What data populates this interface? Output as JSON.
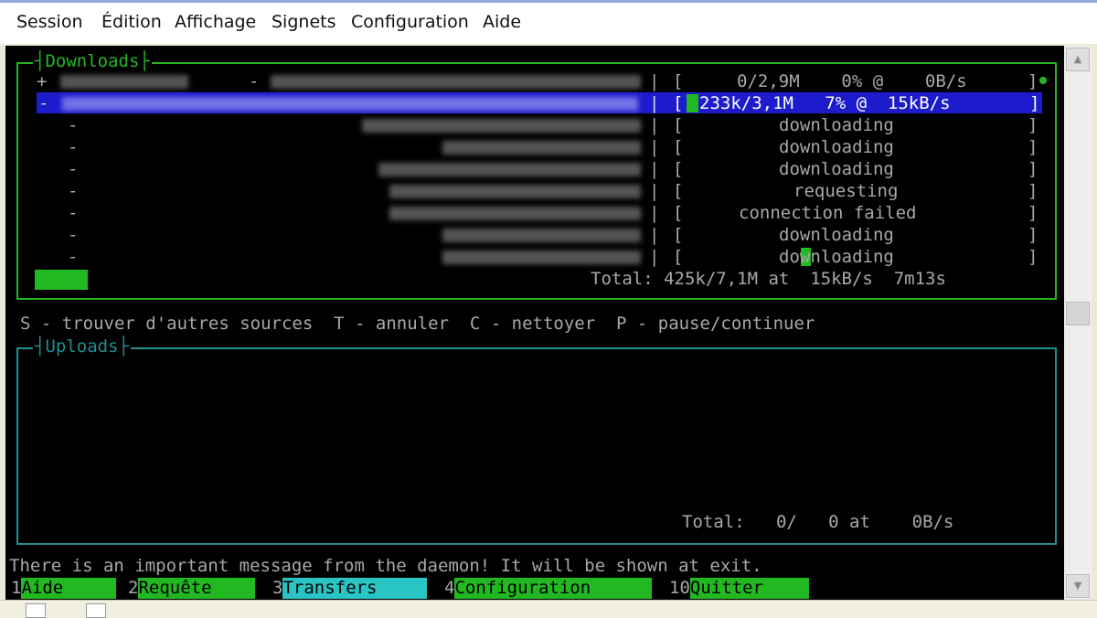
{
  "menubar": [
    "Session",
    "Édition",
    "Affichage",
    "Signets",
    "Configuration",
    "Aide"
  ],
  "downloads": {
    "title": "Downloads",
    "rows": [
      {
        "marker": "+",
        "bracket": "[",
        "status": "0/2,9M    0% @    0B/s",
        "close": "]"
      },
      {
        "marker": "-",
        "bracket": "[",
        "status": "233k/3,1M   7% @  15kB/s",
        "close": "]"
      },
      {
        "marker": "-",
        "bracket": "[",
        "status": "downloading",
        "close": "]"
      },
      {
        "marker": "-",
        "bracket": "[",
        "status": "downloading",
        "close": "]"
      },
      {
        "marker": "-",
        "bracket": "[",
        "status": "downloading",
        "close": "]"
      },
      {
        "marker": "-",
        "bracket": "[",
        "status": "requesting",
        "close": "]"
      },
      {
        "marker": "-",
        "bracket": "[",
        "status": "connection failed",
        "close": "]"
      },
      {
        "marker": "-",
        "bracket": "[",
        "status": "downloading",
        "close": "]"
      },
      {
        "marker": "-",
        "bracket": "[",
        "status": "downloading",
        "close": "]"
      }
    ],
    "total": "Total: 425k/7,1M at  15kB/s  7m13s"
  },
  "commands": "S - trouver d'autres sources  T - annuler  C - nettoyer  P - pause/continuer",
  "uploads": {
    "title": "Uploads",
    "total": "Total:   0/   0 at    0B/s"
  },
  "message": "There is an important message from the daemon! It will be shown at exit.",
  "function_keys": [
    {
      "num": "1",
      "label": "Aide"
    },
    {
      "num": "2",
      "label": "Requête"
    },
    {
      "num": "3",
      "label": "Transfers"
    },
    {
      "num": "4",
      "label": "Configuration"
    },
    {
      "num": "10",
      "label": "Quitter"
    }
  ],
  "colors": {
    "terminal_bg": "#000000",
    "downloads_border": "#25b525",
    "uploads_border": "#1f8f8f",
    "selection": "#1c1ccd",
    "fkey_green": "#22b822",
    "fkey_cyan": "#29c4c4"
  }
}
